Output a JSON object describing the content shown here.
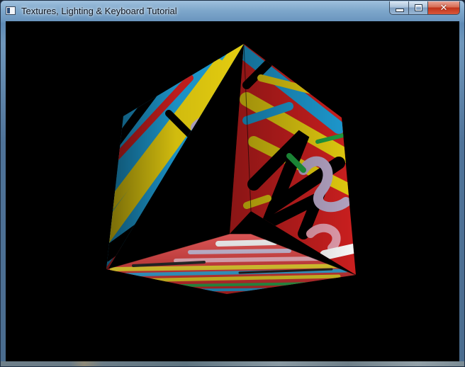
{
  "window": {
    "title": "Textures, Lighting & Keyboard Tutorial",
    "icon": "application-window-icon",
    "controls": {
      "minimize_icon": "minimize-icon",
      "maximize_icon": "maximize-icon",
      "close_icon": "close-icon",
      "close_label": "✕"
    }
  },
  "scene": {
    "object": "textured-cube",
    "background_color": "#000000",
    "texture_colors": [
      "#1e9fd8",
      "#e8d010",
      "#d02020",
      "#20a040",
      "#b8a8c8",
      "#e8a0b0",
      "#000000",
      "#ffffff",
      "#3040c0"
    ]
  }
}
